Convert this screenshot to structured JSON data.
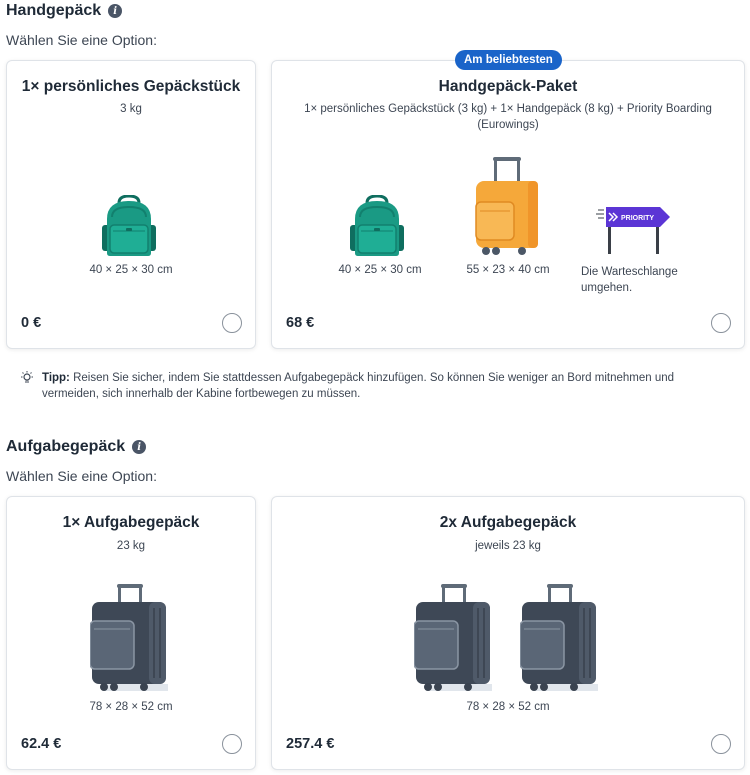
{
  "hand_luggage": {
    "title": "Handgepäck",
    "subtitle": "Wählen Sie eine Option:",
    "option1": {
      "title": "1× persönliches Gepäckstück",
      "weight": "3 kg",
      "dims": "40 × 25 × 30 cm",
      "price": "0 €"
    },
    "option2": {
      "badge": "Am beliebtesten",
      "title": "Handgepäck-Paket",
      "description": "1× persönliches Gepäckstück (3 kg) + 1× Handgepäck (8 kg) + Priority Boarding (Eurowings)",
      "backpack_dims": "40 × 25 × 30 cm",
      "trolley_dims": "55 × 23 × 40 cm",
      "priority_sign": "PRIORITY",
      "priority_text": "Die Warteschlange umgehen.",
      "price": "68 €"
    }
  },
  "tip": {
    "label": "Tipp:",
    "text": " Reisen Sie sicher, indem Sie stattdessen Aufgabegepäck hinzufügen. So können Sie weniger an Bord mitnehmen und vermeiden, sich innerhalb der Kabine fortbewegen zu müssen."
  },
  "checked_luggage": {
    "title": "Aufgabegepäck",
    "subtitle": "Wählen Sie eine Option:",
    "option1": {
      "title": "1× Aufgabegepäck",
      "weight": "23 kg",
      "dims": "78 × 28 × 52 cm",
      "price": "62.4 €"
    },
    "option2": {
      "title": "2x Aufgabegepäck",
      "weight": "jeweils 23 kg",
      "dims": "78 × 28 × 52 cm",
      "price": "257.4 €"
    }
  },
  "colors": {
    "accent_blue": "#1a64c9",
    "backpack_teal": "#1a9a84",
    "trolley_orange": "#f5a83a",
    "suitcase_dark": "#4b5766",
    "priority_purple": "#5b35d5"
  }
}
